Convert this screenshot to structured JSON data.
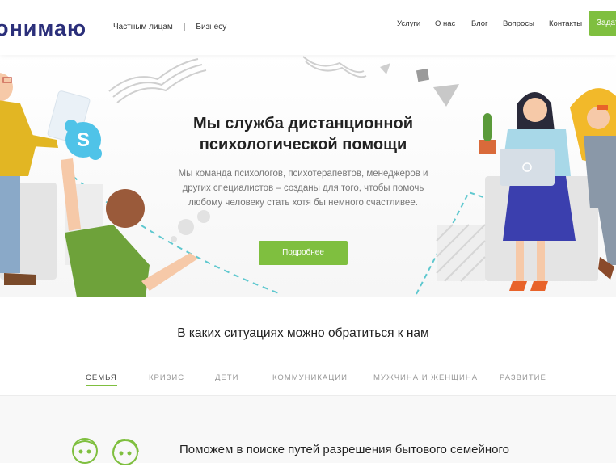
{
  "header": {
    "logo": "онимаю",
    "nav_left": [
      {
        "label": "Частным лицам"
      },
      {
        "label": "Бизнесу"
      }
    ],
    "nav_separator": "|",
    "nav_right": [
      {
        "label": "Услуги"
      },
      {
        "label": "О нас"
      },
      {
        "label": "Блог"
      },
      {
        "label": "Вопросы"
      },
      {
        "label": "Контакты"
      }
    ],
    "cta_label": "Задат"
  },
  "hero": {
    "title_line1": "Мы служба дистанционной",
    "title_line2": "психологической помощи",
    "subtitle_line1": "Мы команда психологов, психотерапевтов, менеджеров и",
    "subtitle_line2": "других специалистов – созданы для того, чтобы помочь",
    "subtitle_line3": "любому человеку стать хотя бы немного счастливее.",
    "button_label": "Подробнее"
  },
  "situations": {
    "title": "В каких ситуациях можно обратиться к нам",
    "tabs": [
      {
        "label": "СЕМЬЯ",
        "active": true
      },
      {
        "label": "КРИЗИС",
        "active": false
      },
      {
        "label": "ДЕТИ",
        "active": false
      },
      {
        "label": "КОММУНИКАЦИИ",
        "active": false
      },
      {
        "label": "МУЖЧИНА И ЖЕНЩИНА",
        "active": false
      },
      {
        "label": "РАЗВИТИЕ",
        "active": false
      }
    ],
    "content_text": "Поможем в поиске путей разрешения бытового семейного"
  },
  "colors": {
    "accent": "#7fbf3f",
    "logo": "#2b2f7a",
    "skype": "#4fc3e8",
    "dress": "#3b3fae"
  },
  "icons": [
    "skype-icon",
    "family-icon"
  ]
}
